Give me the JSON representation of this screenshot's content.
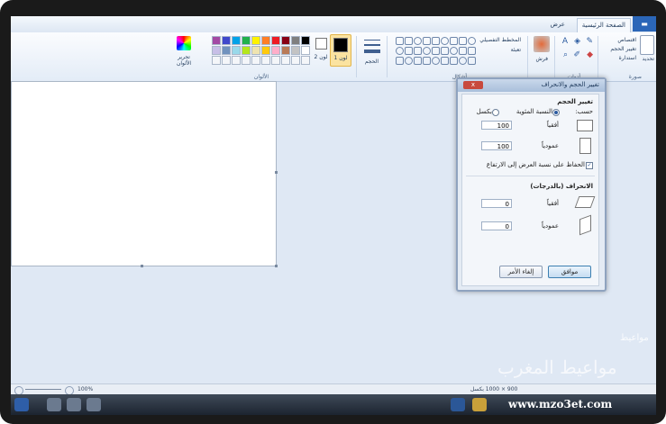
{
  "ribbon_tabs": {
    "file": "",
    "home": "الصفحة الرئيسية",
    "view": "عرض"
  },
  "ribbon": {
    "image_group": {
      "select": "تحديد",
      "crop": "اقتصاص",
      "resize": "تغيير الحجم",
      "rotate": "استدارة",
      "label": "صورة"
    },
    "tools_label": "أدوات",
    "brushes_label": "فرش",
    "shapes_label": "أشكال",
    "outline": "المخطط التفصيلي",
    "fill": "تعبئة",
    "size_label": "الحجم",
    "color1": "لون 1",
    "color2": "لون 2",
    "colors_label": "الألوان",
    "edit_colors": "تحرير الألوان"
  },
  "palette": [
    "#000000",
    "#7f7f7f",
    "#880015",
    "#ed1c24",
    "#ff7f27",
    "#fff200",
    "#22b14c",
    "#00a2e8",
    "#3f48cc",
    "#a349a4",
    "#ffffff",
    "#c3c3c3",
    "#b97a57",
    "#ffaec9",
    "#ffc90e",
    "#efe4b0",
    "#b5e61d",
    "#99d9ea",
    "#7092be",
    "#c8bfe7"
  ],
  "dialog": {
    "title": "تغيير الحجم والانحراف",
    "close": "x",
    "resize_heading": "تغيير الحجم",
    "by_label": "حسب:",
    "percentage": "النسبة المئوية",
    "pixels": "بكسل",
    "horizontal": "أفقياً",
    "vertical": "عمودياً",
    "h_value": "100",
    "v_value": "100",
    "maintain": "الحفاظ على نسبة العرض إلى الارتفاع",
    "skew_heading": "الانحراف (بالدرجات)",
    "skew_h_value": "0",
    "skew_v_value": "0",
    "ok": "موافق",
    "cancel": "إلغاء الأمر"
  },
  "statusbar": {
    "size_text": "900 × 1000 بكسل",
    "zoom": "100%"
  },
  "watermark": {
    "arabic": "مواعيط المغرب",
    "url": "www.mzo3et.com",
    "brand": "مواعيط"
  }
}
